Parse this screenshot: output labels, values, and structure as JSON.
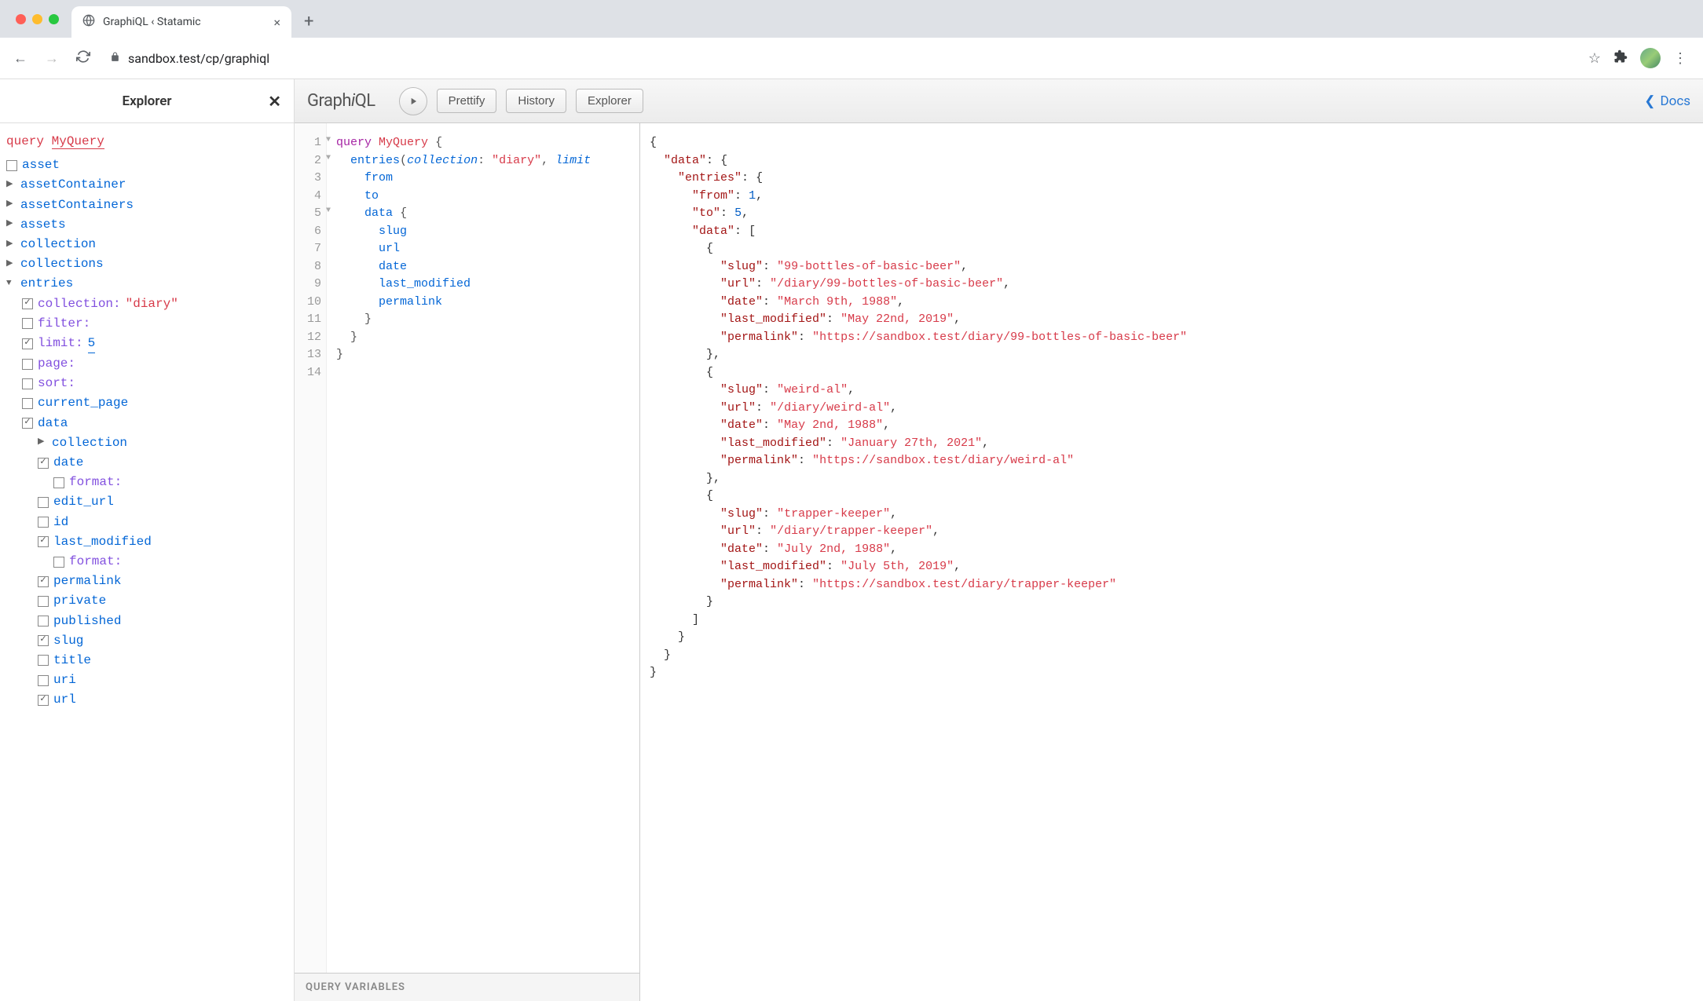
{
  "browser": {
    "tab_title": "GraphiQL ‹ Statamic",
    "url": "sandbox.test/cp/graphiql"
  },
  "explorer": {
    "title": "Explorer",
    "query_keyword": "query",
    "query_name": "MyQuery",
    "root_fields": [
      {
        "name": "asset",
        "type": "checkbox",
        "checked": false
      },
      {
        "name": "assetContainer",
        "type": "caret"
      },
      {
        "name": "assetContainers",
        "type": "caret"
      },
      {
        "name": "assets",
        "type": "caret"
      },
      {
        "name": "collection",
        "type": "caret"
      },
      {
        "name": "collections",
        "type": "caret"
      }
    ],
    "entries_label": "entries",
    "entries_args": [
      {
        "name": "collection:",
        "checked": true,
        "value": "\"diary\"",
        "value_type": "string"
      },
      {
        "name": "filter:",
        "checked": false
      },
      {
        "name": "limit:",
        "checked": true,
        "value": "5",
        "value_type": "num"
      },
      {
        "name": "page:",
        "checked": false
      },
      {
        "name": "sort:",
        "checked": false
      }
    ],
    "entries_fields": [
      {
        "name": "current_page",
        "checked": false,
        "indent": 1,
        "type": "checkbox"
      },
      {
        "name": "data",
        "checked": true,
        "indent": 1,
        "type": "checkbox"
      }
    ],
    "data_children": [
      {
        "name": "collection",
        "type": "caret",
        "indent": 2
      },
      {
        "name": "date",
        "checked": true,
        "indent": 2,
        "type": "checkbox"
      },
      {
        "name": "format:",
        "checked": false,
        "indent": 3,
        "arg": true
      },
      {
        "name": "edit_url",
        "checked": false,
        "indent": 2,
        "type": "checkbox"
      },
      {
        "name": "id",
        "checked": false,
        "indent": 2,
        "type": "checkbox"
      },
      {
        "name": "last_modified",
        "checked": true,
        "indent": 2,
        "type": "checkbox"
      },
      {
        "name": "format:",
        "checked": false,
        "indent": 3,
        "arg": true
      },
      {
        "name": "permalink",
        "checked": true,
        "indent": 2,
        "type": "checkbox"
      },
      {
        "name": "private",
        "checked": false,
        "indent": 2,
        "type": "checkbox"
      },
      {
        "name": "published",
        "checked": false,
        "indent": 2,
        "type": "checkbox"
      },
      {
        "name": "slug",
        "checked": true,
        "indent": 2,
        "type": "checkbox"
      },
      {
        "name": "title",
        "checked": false,
        "indent": 2,
        "type": "checkbox"
      },
      {
        "name": "uri",
        "checked": false,
        "indent": 2,
        "type": "checkbox"
      },
      {
        "name": "url",
        "checked": true,
        "indent": 2,
        "type": "checkbox"
      }
    ]
  },
  "toolbar": {
    "logo_prefix": "Graph",
    "logo_i": "i",
    "logo_suffix": "QL",
    "prettify": "Prettify",
    "history": "History",
    "explorer": "Explorer",
    "docs": "Docs"
  },
  "query_editor": {
    "lines": [
      {
        "n": 1,
        "fold": true
      },
      {
        "n": 2,
        "fold": true
      },
      {
        "n": 3
      },
      {
        "n": 4
      },
      {
        "n": 5,
        "fold": true
      },
      {
        "n": 6
      },
      {
        "n": 7
      },
      {
        "n": 8
      },
      {
        "n": 9
      },
      {
        "n": 10
      },
      {
        "n": 11
      },
      {
        "n": 12
      },
      {
        "n": 13
      },
      {
        "n": 14
      }
    ],
    "tokens": {
      "query": "query",
      "name": "MyQuery",
      "entries": "entries",
      "collection_arg": "collection",
      "collection_val": "\"diary\"",
      "limit_arg": "limit",
      "from": "from",
      "to": "to",
      "data": "data",
      "slug": "slug",
      "url": "url",
      "date": "date",
      "last_modified": "last_modified",
      "permalink": "permalink"
    },
    "vars_label": "QUERY VARIABLES"
  },
  "result": {
    "data": {
      "entries": {
        "from": 1,
        "to": 5,
        "data": [
          {
            "slug": "99-bottles-of-basic-beer",
            "url": "/diary/99-bottles-of-basic-beer",
            "date": "March 9th, 1988",
            "last_modified": "May 22nd, 2019",
            "permalink": "https://sandbox.test/diary/99-bottles-of-basic-beer"
          },
          {
            "slug": "weird-al",
            "url": "/diary/weird-al",
            "date": "May 2nd, 1988",
            "last_modified": "January 27th, 2021",
            "permalink": "https://sandbox.test/diary/weird-al"
          },
          {
            "slug": "trapper-keeper",
            "url": "/diary/trapper-keeper",
            "date": "July 2nd, 1988",
            "last_modified": "July 5th, 2019",
            "permalink": "https://sandbox.test/diary/trapper-keeper"
          }
        ]
      }
    }
  }
}
